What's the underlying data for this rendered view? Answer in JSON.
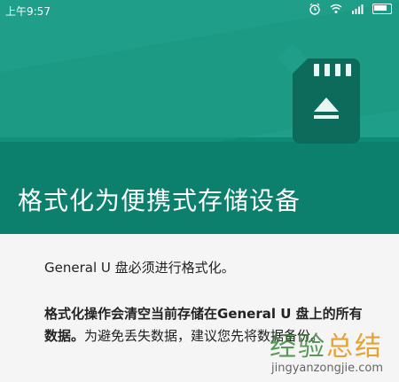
{
  "status_bar": {
    "time": "上午9:57",
    "icons": [
      "alarm-icon",
      "wifi-icon",
      "signal-icon",
      "battery-icon"
    ]
  },
  "header": {
    "title": "格式化为便携式存储设备",
    "illustration": "sd-card-eject-icon"
  },
  "body": {
    "line1": "General U 盘必须进行格式化。",
    "warning_bold": "格式化操作会清空当前存储在General U 盘上的所有数据。",
    "warning_normal": "为避免丢失数据，建议您先将数据备份。"
  },
  "watermark": {
    "logo_part1": "经验",
    "logo_part2": "总结",
    "url": "jingyanzongjie.com"
  },
  "colors": {
    "header_primary": "#0f8a77",
    "header_light": "#1f9e89",
    "card": "#0c6b5a",
    "text": "#222222"
  }
}
